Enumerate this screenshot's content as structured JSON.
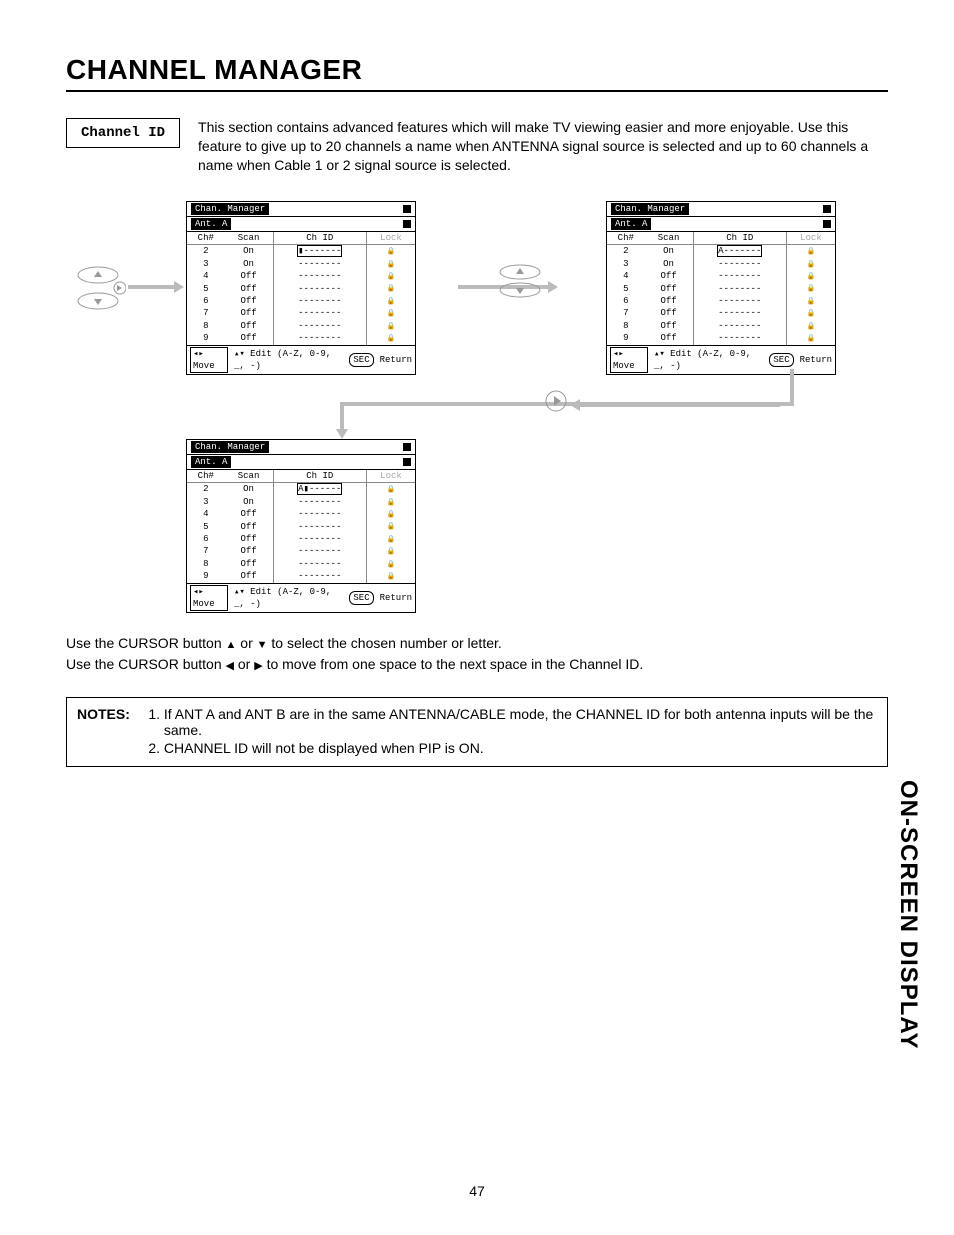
{
  "page_title": "CHANNEL MANAGER",
  "side_tab": "ON-SCREEN DISPLAY",
  "page_number": "47",
  "chip_label": "Channel ID",
  "intro_text": "This section contains advanced features which will make TV viewing easier and more enjoyable.  Use this feature to give up to 20 channels a name when ANTENNA signal source is selected and up to 60 channels a name when Cable 1 or 2 signal source is selected.",
  "osd": {
    "title": "Chan. Manager",
    "ant": "Ant. A",
    "headers": {
      "ch": "Ch#",
      "scan": "Scan",
      "chid": "Ch ID",
      "lock": "Lock"
    },
    "footer": {
      "move": "Move",
      "edit": "Edit (A-Z, 0-9, _, -)",
      "return": "Return",
      "sec": "SEC",
      "arrows_lr": "◂▸",
      "arrows_ud": "▴▾"
    },
    "panelA_rows": [
      {
        "ch": "2",
        "scan": "On",
        "chid": "▮-------",
        "lock": true,
        "sel": true
      },
      {
        "ch": "3",
        "scan": "On",
        "chid": "--------",
        "lock": true
      },
      {
        "ch": "4",
        "scan": "Off",
        "chid": "--------",
        "lock": true
      },
      {
        "ch": "5",
        "scan": "Off",
        "chid": "--------",
        "lock": true
      },
      {
        "ch": "6",
        "scan": "Off",
        "chid": "--------",
        "lock": true
      },
      {
        "ch": "7",
        "scan": "Off",
        "chid": "--------",
        "lock": true
      },
      {
        "ch": "8",
        "scan": "Off",
        "chid": "--------",
        "lock": true
      },
      {
        "ch": "9",
        "scan": "Off",
        "chid": "--------",
        "lock": true
      }
    ],
    "panelB_rows": [
      {
        "ch": "2",
        "scan": "On",
        "chid": "A-------",
        "lock": true,
        "sel": true
      },
      {
        "ch": "3",
        "scan": "On",
        "chid": "--------",
        "lock": true
      },
      {
        "ch": "4",
        "scan": "Off",
        "chid": "--------",
        "lock": true
      },
      {
        "ch": "5",
        "scan": "Off",
        "chid": "--------",
        "lock": true
      },
      {
        "ch": "6",
        "scan": "Off",
        "chid": "--------",
        "lock": true
      },
      {
        "ch": "7",
        "scan": "Off",
        "chid": "--------",
        "lock": true
      },
      {
        "ch": "8",
        "scan": "Off",
        "chid": "--------",
        "lock": true
      },
      {
        "ch": "9",
        "scan": "Off",
        "chid": "--------",
        "lock": true
      }
    ],
    "panelC_rows": [
      {
        "ch": "2",
        "scan": "On",
        "chid": "A▮------",
        "lock": true,
        "sel": true
      },
      {
        "ch": "3",
        "scan": "On",
        "chid": "--------",
        "lock": true
      },
      {
        "ch": "4",
        "scan": "Off",
        "chid": "--------",
        "lock": true
      },
      {
        "ch": "5",
        "scan": "Off",
        "chid": "--------",
        "lock": true
      },
      {
        "ch": "6",
        "scan": "Off",
        "chid": "--------",
        "lock": true
      },
      {
        "ch": "7",
        "scan": "Off",
        "chid": "--------",
        "lock": true
      },
      {
        "ch": "8",
        "scan": "Off",
        "chid": "--------",
        "lock": true
      },
      {
        "ch": "9",
        "scan": "Off",
        "chid": "--------",
        "lock": true
      }
    ]
  },
  "instructions": {
    "line1_a": "Use the CURSOR button ",
    "line1_b": " or ",
    "line1_c": " to select the chosen number or letter.",
    "up": "▲",
    "down": "▼",
    "left": "◀",
    "right": "▶",
    "line2_a": "Use the CURSOR button ",
    "line2_b": " or ",
    "line2_c": " to move from one space to the next space in the Channel ID."
  },
  "notes": {
    "label": "NOTES:",
    "items": [
      "If ANT A and ANT B are in the same ANTENNA/CABLE mode, the CHANNEL ID for both antenna inputs will be the same.",
      "CHANNEL ID will not be displayed when PIP is ON."
    ]
  }
}
